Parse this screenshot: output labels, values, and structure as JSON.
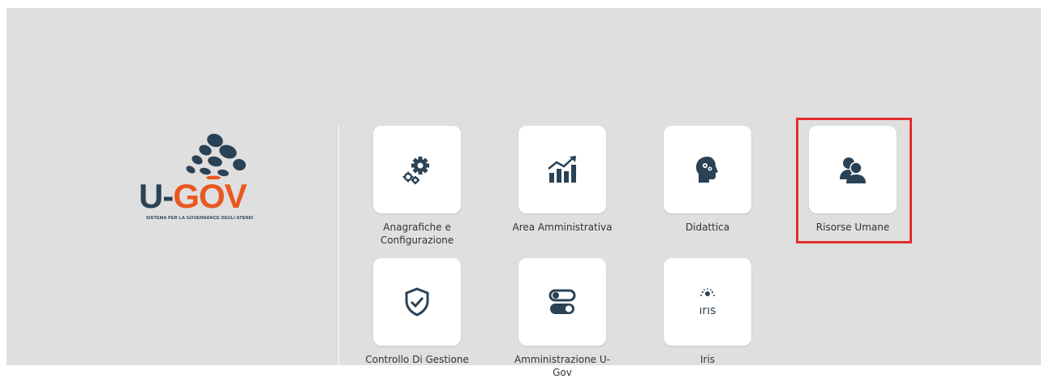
{
  "brand": {
    "logo_text_u": "U-",
    "logo_text_gov": "GOV",
    "tagline": "SISTEMA PER LA GOVERNANCE DEGLI ATENEI",
    "color_primary": "#2a4256",
    "color_accent": "#e8591f"
  },
  "modules": [
    {
      "label": "Anagrafiche e Configurazione",
      "icon": "gears-icon"
    },
    {
      "label": "Area Amministrativa",
      "icon": "bar-chart-growth-icon"
    },
    {
      "label": "Didattica",
      "icon": "brain-head-icon"
    },
    {
      "label": "Risorse Umane",
      "icon": "users-icon",
      "highlighted": true
    },
    {
      "label": "Controllo Di Gestione",
      "icon": "shield-check-icon"
    },
    {
      "label": "Amministrazione U-Gov",
      "icon": "toggles-icon"
    },
    {
      "label": "Iris",
      "icon": "iris-logo-icon"
    }
  ],
  "highlight_color": "#e32e2e",
  "icon_color": "#2a4256"
}
